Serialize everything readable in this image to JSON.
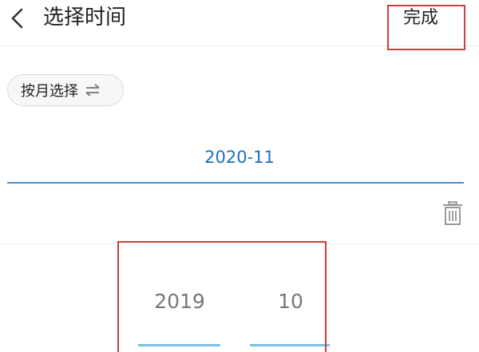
{
  "header": {
    "title": "选择时间",
    "done_label": "完成"
  },
  "mode_chip": {
    "label": "按月选择",
    "icon": "swap-arrows-icon"
  },
  "selected": {
    "value": "2020-11"
  },
  "picker": {
    "year": "2019",
    "month": "10"
  },
  "icons": {
    "back": "chevron-left-icon",
    "trash": "trash-icon"
  },
  "colors": {
    "accent_blue": "#1f6fb8",
    "picker_line": "#7bbfe0",
    "highlight_red": "#c9403f"
  }
}
